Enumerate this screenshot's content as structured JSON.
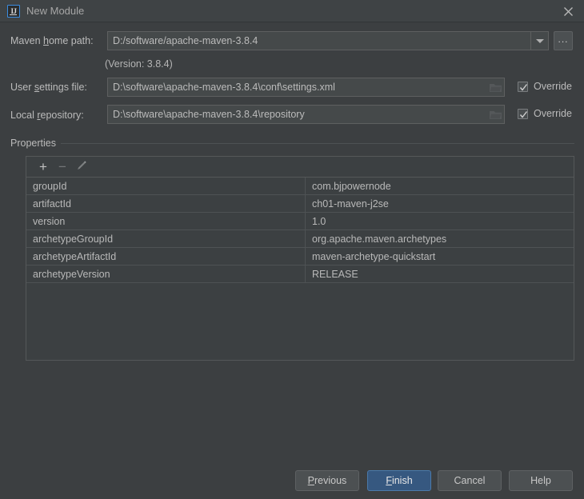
{
  "window": {
    "title": "New Module",
    "app_icon": "intellij-idea-icon",
    "close_icon": "close-icon"
  },
  "form": {
    "maven_home": {
      "label_before": "Maven ",
      "label_accel": "h",
      "label_after": "ome path:",
      "value": "D:/software/apache-maven-3.8.4",
      "dropdown_icon": "chevron-down-icon",
      "browse_label": "...",
      "version_note": "(Version: 3.8.4)"
    },
    "user_settings": {
      "label_before": "User ",
      "label_accel": "s",
      "label_after": "ettings file:",
      "value": "D:\\software\\apache-maven-3.8.4\\conf\\settings.xml",
      "folder_icon": "folder-icon",
      "override_label": "Override",
      "override_checked": true
    },
    "local_repository": {
      "label_before": "Local ",
      "label_accel": "r",
      "label_after": "epository:",
      "value": "D:\\software\\apache-maven-3.8.4\\repository",
      "folder_icon": "folder-icon",
      "override_label": "Override",
      "override_checked": true
    }
  },
  "properties": {
    "section_label": "Properties",
    "toolbar": {
      "add_label": "+",
      "remove_label": "−",
      "edit_icon": "pencil-icon"
    },
    "rows": [
      {
        "key": "groupId",
        "value": "com.bjpowernode"
      },
      {
        "key": "artifactId",
        "value": "ch01-maven-j2se"
      },
      {
        "key": "version",
        "value": "1.0"
      },
      {
        "key": "archetypeGroupId",
        "value": "org.apache.maven.archetypes"
      },
      {
        "key": "archetypeArtifactId",
        "value": "maven-archetype-quickstart"
      },
      {
        "key": "archetypeVersion",
        "value": "RELEASE"
      }
    ]
  },
  "buttons": {
    "previous": {
      "before": "",
      "accel": "P",
      "after": "revious"
    },
    "finish": {
      "before": "",
      "accel": "F",
      "after": "inish"
    },
    "cancel": {
      "label": "Cancel"
    },
    "help": {
      "label": "Help"
    }
  },
  "colors": {
    "dialog_bg": "#3c3f41",
    "titlebar_bg": "#3f4345",
    "field_bg": "#45494a",
    "accent_blue": "#365880",
    "icon_border_blue": "#3b8ce0",
    "text": "#bbbbbb"
  }
}
